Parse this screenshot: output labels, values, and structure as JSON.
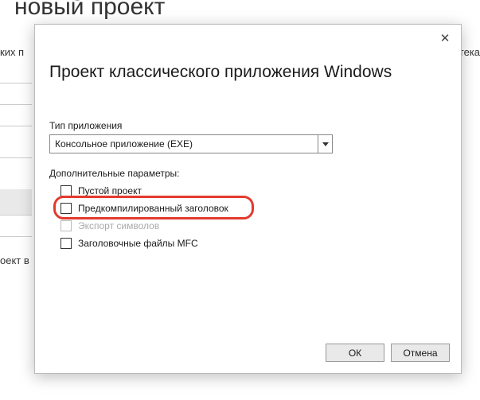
{
  "background": {
    "title": "новый проект",
    "left_fragment": "ких п",
    "right_fragment": "отека",
    "bottom_fragment": "оект в"
  },
  "dialog": {
    "close_glyph": "✕",
    "title": "Проект классического приложения Windows",
    "type_label": "Тип приложения",
    "type_value": "Консольное приложение (EXE)",
    "additional_label": "Дополнительные параметры:",
    "options": [
      {
        "label": "Пустой проект",
        "checked": false,
        "disabled": false
      },
      {
        "label": "Предкомпилированный заголовок",
        "checked": false,
        "disabled": false
      },
      {
        "label": "Экспорт символов",
        "checked": false,
        "disabled": true
      },
      {
        "label": "Заголовочные файлы MFC",
        "checked": false,
        "disabled": false
      }
    ],
    "ok_label": "ОК",
    "cancel_label": "Отмена"
  }
}
